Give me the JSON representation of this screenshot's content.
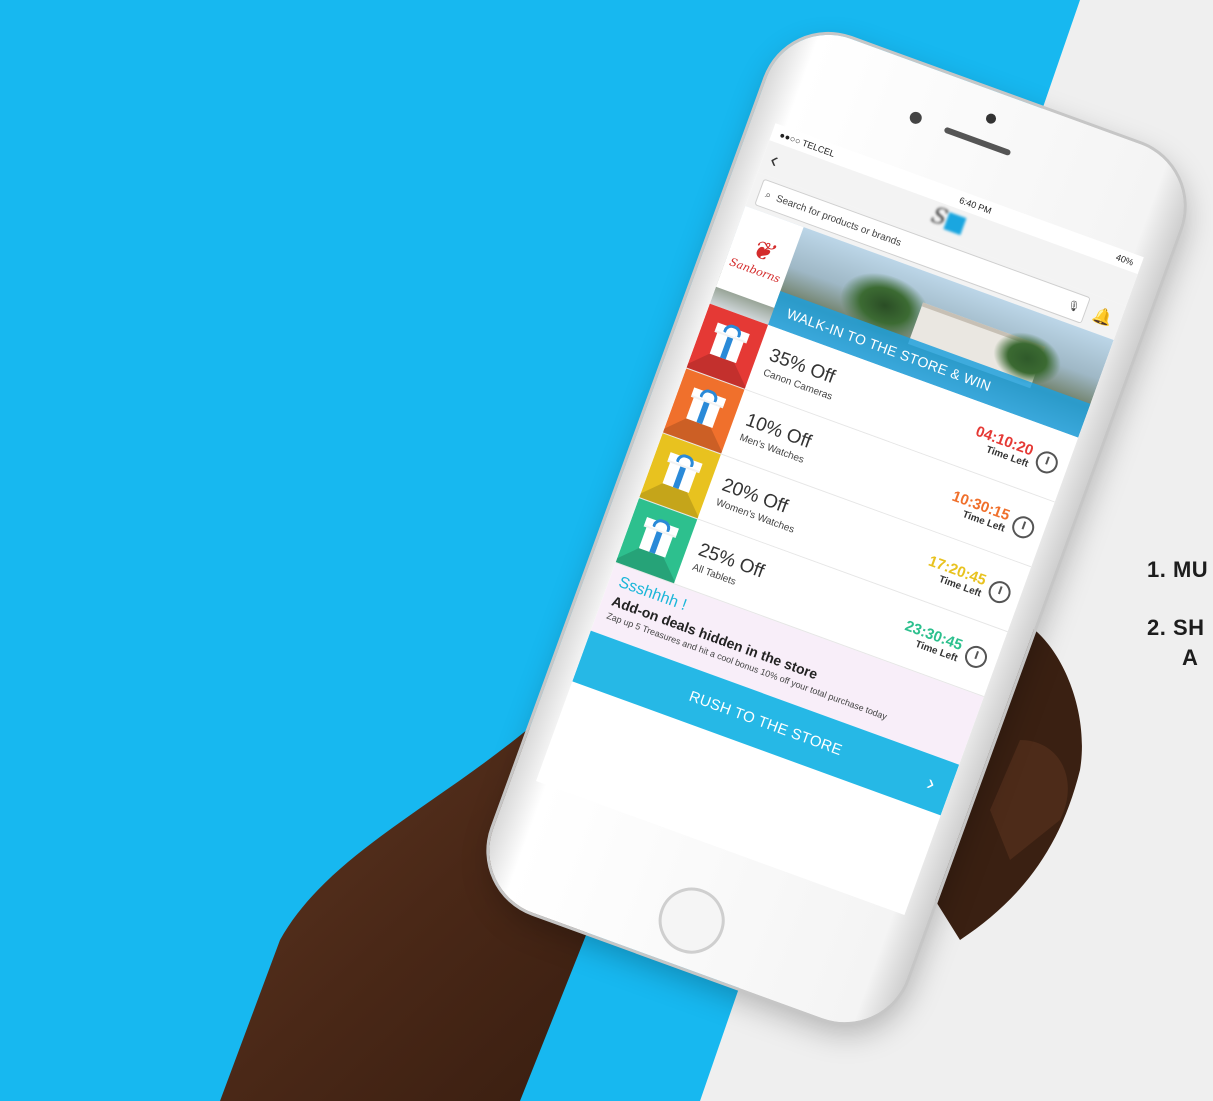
{
  "side_text": {
    "line1": "1. MU",
    "line2": "2. SH",
    "line3": "A"
  },
  "phone": {
    "status": {
      "carrier": "●●○○ TELCEL",
      "time": "6:40 PM",
      "battery": "40%"
    },
    "search": {
      "placeholder": "Search for products or brands"
    },
    "banner": {
      "brand": "Sanborns",
      "headline": "WALK-IN TO THE STORE & WIN"
    },
    "deals": [
      {
        "percent": "35% Off",
        "item": "Canon Cameras",
        "time": "04:10:20",
        "time_label": "Time Left",
        "color": "#e53935"
      },
      {
        "percent": "10% Off",
        "item": "Men's Watches",
        "time": "10:30:15",
        "time_label": "Time Left",
        "color": "#f0702c"
      },
      {
        "percent": "20% Off",
        "item": "Women's Watches",
        "time": "17:20:45",
        "time_label": "Time Left",
        "color": "#e8c21f"
      },
      {
        "percent": "25% Off",
        "item": "All Tablets",
        "time": "23:30:45",
        "time_label": "Time Left",
        "color": "#2dc08e"
      }
    ],
    "addon": {
      "title": "Ssshhhh !",
      "subtitle": "Add-on deals hidden in the store",
      "description": "Zap up 5 Treasures and hit a cool bonus 10% off your total purchase today"
    },
    "cta": {
      "label": "RUSH TO THE STORE"
    }
  },
  "icons": {
    "back": "chevron-left-icon",
    "search": "search-icon",
    "bell": "bell-icon",
    "mic": "microphone-icon",
    "gift": "gift-icon",
    "timer": "timer-icon",
    "chevron": "chevron-right-icon"
  }
}
